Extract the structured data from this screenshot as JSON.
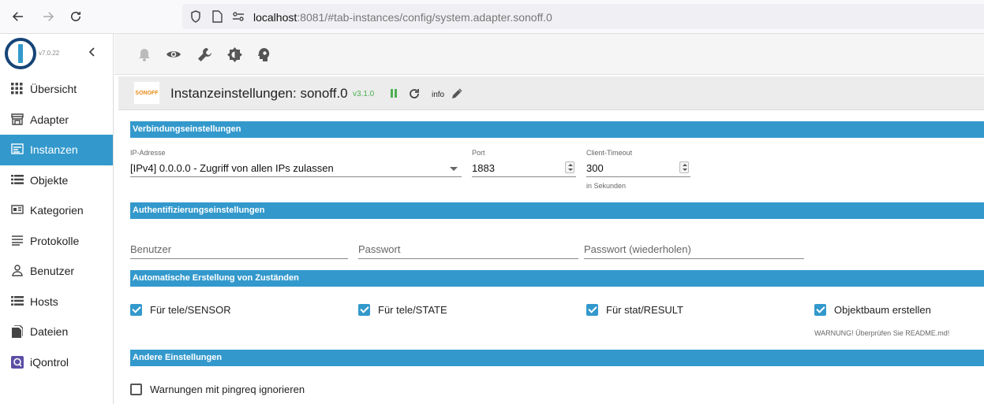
{
  "browser": {
    "url_host": "localhost",
    "url_rest": ":8081/#tab-instances/config/system.adapter.sonoff.0"
  },
  "sidebar": {
    "version": "v7.0.22",
    "items": [
      {
        "label": "Übersicht",
        "icon": "apps-grid-icon",
        "active": false
      },
      {
        "label": "Adapter",
        "icon": "store-icon",
        "active": false
      },
      {
        "label": "Instanzen",
        "icon": "instances-icon",
        "active": true
      },
      {
        "label": "Objekte",
        "icon": "list-icon",
        "active": false
      },
      {
        "label": "Kategorien",
        "icon": "categories-icon",
        "active": false
      },
      {
        "label": "Protokolle",
        "icon": "log-lines-icon",
        "active": false
      },
      {
        "label": "Benutzer",
        "icon": "user-icon",
        "active": false
      },
      {
        "label": "Hosts",
        "icon": "hosts-icon",
        "active": false
      },
      {
        "label": "Dateien",
        "icon": "files-icon",
        "active": false
      },
      {
        "label": "iQontrol",
        "icon": "iqontrol-icon",
        "active": false
      }
    ]
  },
  "instance": {
    "logo_text": "SONOFF",
    "title": "Instanzeinstellungen: sonoff.0",
    "version": "v3.1.0",
    "info": "info"
  },
  "sections": {
    "connection": "Verbindungseinstellungen",
    "auth": "Authentifizierungseinstellungen",
    "auto": "Automatische Erstellung von Zuständen",
    "other": "Andere Einstellungen"
  },
  "connection": {
    "ip_label": "IP-Adresse",
    "ip_value": "[IPv4] 0.0.0.0 - Zugriff von allen IPs zulassen",
    "port_label": "Port",
    "port_value": "1883",
    "timeout_label": "Client-Timeout",
    "timeout_value": "300",
    "timeout_helper": "in Sekunden"
  },
  "auth": {
    "user_placeholder": "Benutzer",
    "password_placeholder": "Passwort",
    "password_repeat_placeholder": "Passwort (wiederholen)"
  },
  "auto": {
    "sensor": {
      "label": "Für tele/SENSOR",
      "checked": true
    },
    "state": {
      "label": "Für tele/STATE",
      "checked": true
    },
    "result": {
      "label": "Für stat/RESULT",
      "checked": true
    },
    "tree": {
      "label": "Objektbaum erstellen",
      "checked": true
    },
    "warning": "WARNUNG! Überprüfen Sie README.md!"
  },
  "other": {
    "pingreq": {
      "label": "Warnungen mit pingreq ignorieren",
      "checked": false
    }
  },
  "colors": {
    "accent": "#3399cc",
    "running": "#4caf50",
    "brand_dark": "#164477"
  }
}
